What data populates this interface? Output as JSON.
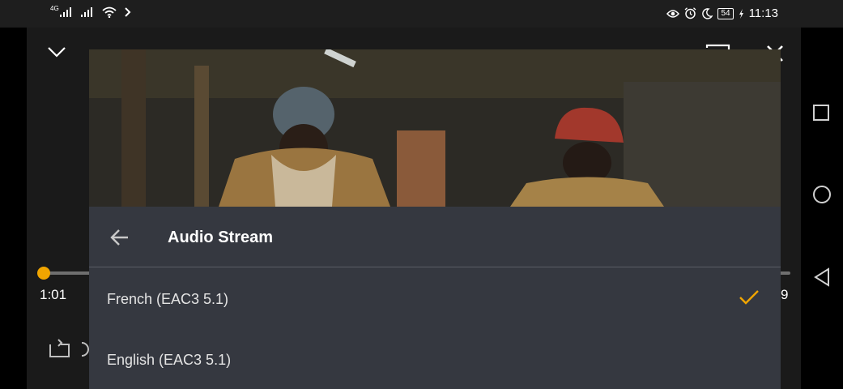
{
  "status_bar": {
    "network_type": "4G",
    "battery": "54",
    "time": "11:13",
    "icons": [
      "signal-icon",
      "signal-icon",
      "wifi-icon",
      "chevron-right-icon",
      "eye-icon",
      "alarm-icon",
      "moon-icon",
      "battery-icon",
      "charging-icon"
    ]
  },
  "player": {
    "top_icons": [
      "chevron-down-icon",
      "cast-icon",
      "close-icon"
    ],
    "progress": {
      "current_time": "1:01",
      "end_time_partial": "9",
      "fraction": 0.0
    },
    "bottom_icons": [
      "repeat-icon"
    ]
  },
  "audio_panel": {
    "title": "Audio Stream",
    "options": [
      {
        "label": "French (EAC3 5.1)",
        "selected": true
      },
      {
        "label": "English (EAC3 5.1)",
        "selected": false
      }
    ]
  },
  "nav_bar": {
    "icons": [
      "recents-square-icon",
      "home-circle-icon",
      "back-triangle-icon"
    ]
  },
  "colors": {
    "accent": "#f0a500",
    "panel": "#353840",
    "player_bg": "#1a1a1a"
  }
}
